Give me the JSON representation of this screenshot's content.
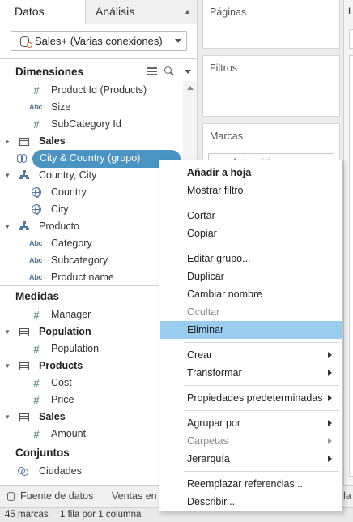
{
  "tabs": {
    "data": "Datos",
    "analysis": "Análisis"
  },
  "datasource": {
    "label": "Sales+ (Varias conexiones)"
  },
  "dimensions": {
    "header": "Dimensiones",
    "items": [
      {
        "label": "Product Id (Products)",
        "type": "number"
      },
      {
        "label": "Size",
        "type": "string"
      },
      {
        "label": "SubCategory Id",
        "type": "number"
      },
      {
        "label": "Sales",
        "type": "table"
      },
      {
        "label": "City & Country (grupo)",
        "type": "group"
      },
      {
        "label": "Country, City",
        "type": "hierarchy"
      },
      {
        "label": "Country",
        "type": "geo"
      },
      {
        "label": "City",
        "type": "geo"
      },
      {
        "label": "Producto",
        "type": "hierarchy"
      },
      {
        "label": "Category",
        "type": "string"
      },
      {
        "label": "Subcategory",
        "type": "string"
      },
      {
        "label": "Product name",
        "type": "string"
      }
    ]
  },
  "measures": {
    "header": "Medidas",
    "items": [
      {
        "label": "Manager",
        "type": "number"
      },
      {
        "label": "Population",
        "type": "table"
      },
      {
        "label": "Population",
        "type": "number"
      },
      {
        "label": "Products",
        "type": "table"
      },
      {
        "label": "Cost",
        "type": "number"
      },
      {
        "label": "Price",
        "type": "number"
      },
      {
        "label": "Sales",
        "type": "table"
      },
      {
        "label": "Amount",
        "type": "number"
      }
    ]
  },
  "sets": {
    "header": "Conjuntos",
    "items": [
      {
        "label": "Ciudades",
        "type": "set"
      }
    ]
  },
  "shelves": {
    "pages": "Páginas",
    "filters": "Filtros",
    "marks": "Marcas",
    "marks_type": "Automático"
  },
  "right_pane": {
    "tab": "i"
  },
  "bottom_tabs": {
    "source": "Fuente de datos",
    "sheet": "Ventas en",
    "trail": "la"
  },
  "status": {
    "marks": "45 marcas",
    "rows": "1 fila por 1 columna"
  },
  "context_menu": {
    "items": [
      {
        "label": "Añadir a hoja",
        "bold": true
      },
      {
        "label": "Mostrar filtro"
      },
      {
        "separator": true
      },
      {
        "label": "Cortar"
      },
      {
        "label": "Copiar"
      },
      {
        "separator": true
      },
      {
        "label": "Editar grupo..."
      },
      {
        "label": "Duplicar"
      },
      {
        "label": "Cambiar nombre"
      },
      {
        "label": "Ocultar",
        "disabled": true
      },
      {
        "label": "Eliminar",
        "highlighted": true
      },
      {
        "separator": true
      },
      {
        "label": "Crear",
        "submenu": true
      },
      {
        "label": "Transformar",
        "submenu": true
      },
      {
        "separator": true
      },
      {
        "label": "Propiedades predeterminadas",
        "submenu": true
      },
      {
        "separator": true
      },
      {
        "label": "Agrupar por",
        "submenu": true
      },
      {
        "label": "Carpetas",
        "submenu": true,
        "disabled": true
      },
      {
        "label": "Jerarquía",
        "submenu": true
      },
      {
        "separator": true
      },
      {
        "label": "Reemplazar referencias..."
      },
      {
        "label": "Describir..."
      }
    ]
  },
  "colors": {
    "selection_pill": "#4a94c3",
    "menu_highlight": "#99ccee",
    "measure_icon": "#3a7e63",
    "dimension_icon": "#4e79a7"
  }
}
